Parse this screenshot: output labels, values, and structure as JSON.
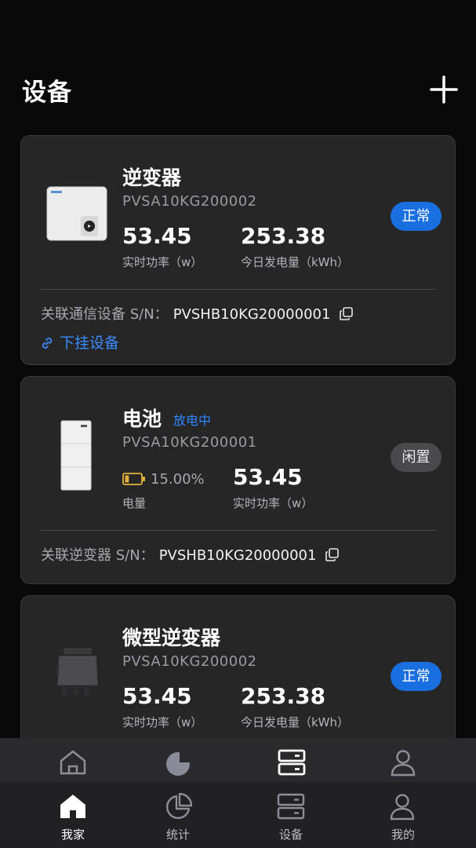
{
  "header": {
    "title": "设备",
    "add_icon": "plus-icon"
  },
  "devices": [
    {
      "name": "逆变器",
      "sn": "PVSA10KG200002",
      "badge": "正常",
      "metrics": [
        {
          "value": "53.45",
          "label": "实时功率（w）"
        },
        {
          "value": "253.38",
          "label": "今日发电量（kWh）"
        }
      ],
      "link_label": "关联通信设备 S/N：",
      "link_sn": "PVSHB10KG20000001",
      "sub_link": "下挂设备"
    },
    {
      "name": "电池",
      "state": "放电中",
      "sn": "PVSA10KG200001",
      "badge": "闲置",
      "battery_percent": "15.00%",
      "battery_level": 0.15,
      "metrics": [
        {
          "value": "53.45",
          "label": "实时功率（w）"
        }
      ],
      "capacity_label": "电量",
      "link_label": "关联逆变器 S/N：",
      "link_sn": "PVSHB10KG20000001"
    },
    {
      "name": "微型逆变器",
      "sn": "PVSA10KG200002",
      "badge": "正常",
      "metrics": [
        {
          "value": "53.45",
          "label": "实时功率（w）"
        },
        {
          "value": "253.38",
          "label": "今日发电量（kWh）"
        }
      ]
    }
  ],
  "tabs": [
    {
      "label": "我家",
      "icon": "home-icon",
      "active": true
    },
    {
      "label": "统计",
      "icon": "pie-chart-icon",
      "active": false
    },
    {
      "label": "设备",
      "icon": "device-icon",
      "active": false
    },
    {
      "label": "我的",
      "icon": "user-icon",
      "active": false
    }
  ],
  "colors": {
    "accent": "#1a6fe0",
    "link": "#3a8dff",
    "background": "#090909",
    "card": "#262627"
  }
}
